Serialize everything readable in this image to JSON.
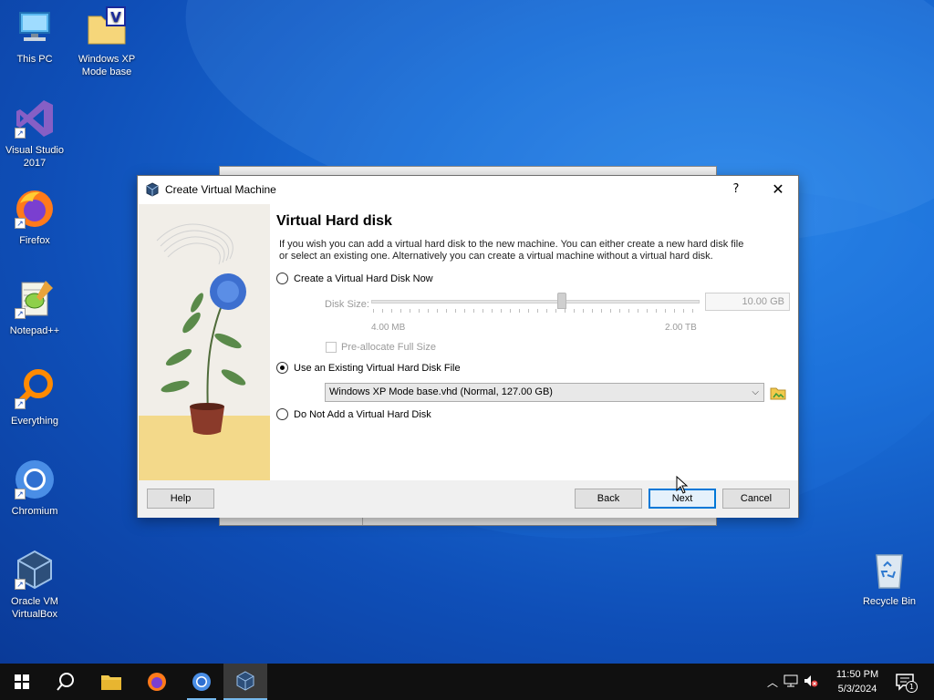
{
  "desktop": {
    "icons": [
      {
        "label": "This PC"
      },
      {
        "label": "Windows XP Mode base"
      },
      {
        "label": "Visual Studio 2017"
      },
      {
        "label": "Firefox"
      },
      {
        "label": "Notepad++"
      },
      {
        "label": "Everything"
      },
      {
        "label": "Chromium"
      },
      {
        "label": "Oracle VM VirtualBox"
      },
      {
        "label": "Recycle Bin"
      }
    ]
  },
  "dialog": {
    "title": "Create Virtual Machine",
    "help_glyph": "?",
    "close_glyph": "✕",
    "heading": "Virtual Hard disk",
    "description": "If you wish you can add a virtual hard disk to the new machine. You can either create a new hard disk file or select an existing one. Alternatively you can create a virtual machine without a virtual hard disk.",
    "options": {
      "create_now": "Create a Virtual Hard Disk Now",
      "use_existing": "Use an Existing Virtual Hard Disk File",
      "do_not_add": "Do Not Add a Virtual Hard Disk"
    },
    "selected_option": "use_existing",
    "disk_size_label": "Disk Size:",
    "disk_size_value": "10.00 GB",
    "disk_size_fraction": 0.58,
    "slider_min_label": "4.00 MB",
    "slider_max_label": "2.00 TB",
    "preallocate_label": "Pre-allocate Full Size",
    "existing_file": "Windows XP Mode base.vhd (Normal, 127.00 GB)",
    "buttons": {
      "help": "Help",
      "back": "Back",
      "next": "Next",
      "cancel": "Cancel"
    }
  },
  "taskbar": {
    "time": "11:50 PM",
    "date": "5/3/2024",
    "notification_count": "1"
  },
  "colors": {
    "accent": "#0078d7",
    "taskbar": "#101010"
  }
}
